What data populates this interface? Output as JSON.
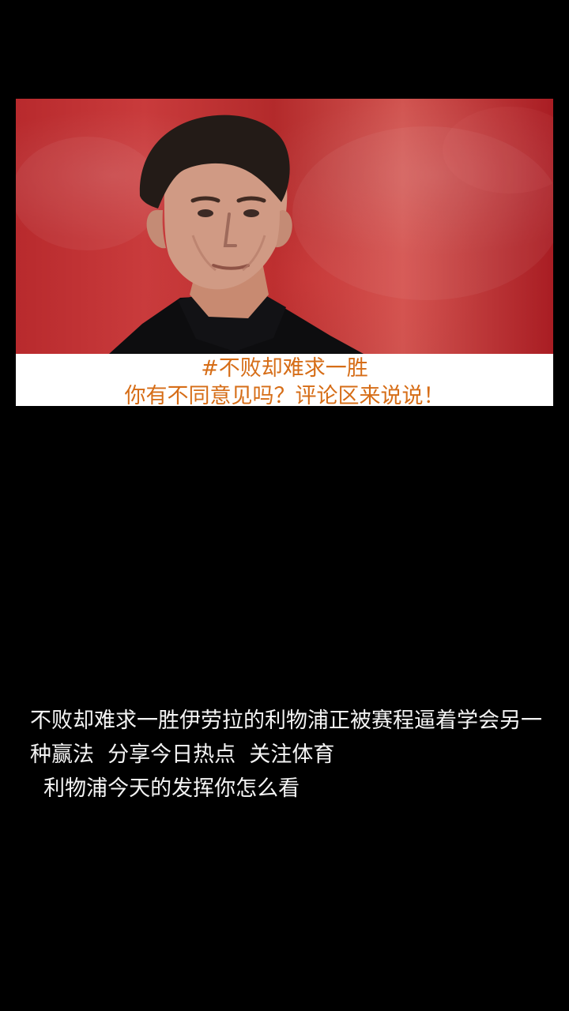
{
  "video": {
    "caption_line_1": "#不败却难求一胜",
    "caption_line_2": "你有不同意见吗？评论区来说说！"
  },
  "post": {
    "description": "不败却难求一胜伊劳拉的利物浦正被赛程逼着学会另一种赢法  分享今日热点  关注体育\n  利物浦今天的发挥你怎么看"
  },
  "colors": {
    "page_background": "#000000",
    "caption_text": "#d66d17",
    "description_text": "#f4f4f4"
  }
}
